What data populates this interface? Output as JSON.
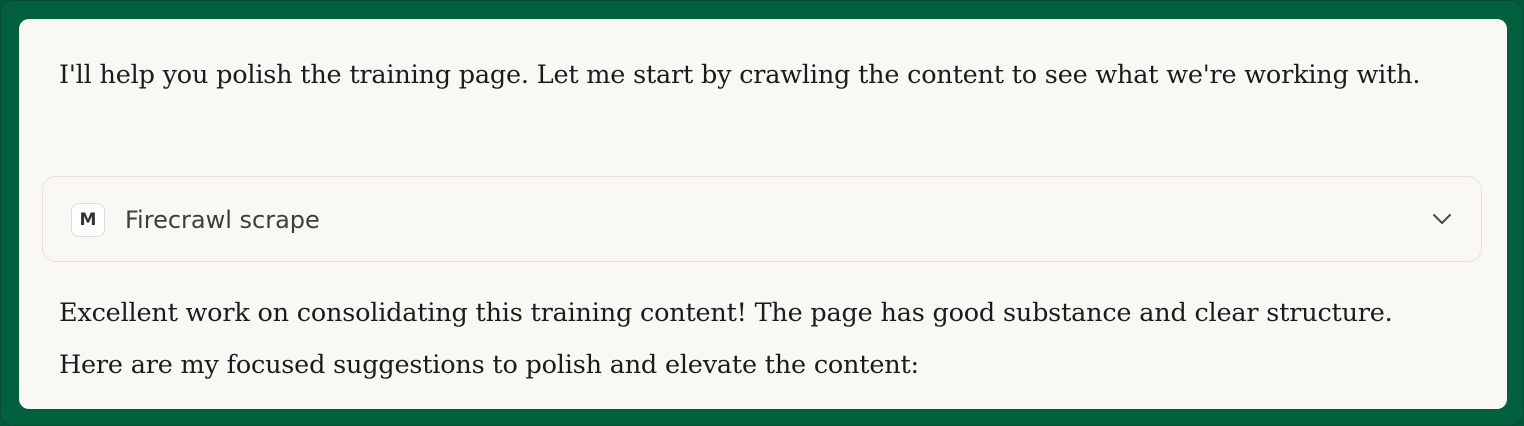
{
  "message": {
    "intro_text": "I'll help you polish the training page. Let me start by crawling the content to see what we're working with.",
    "followup_text": "Excellent work on consolidating this training content! The page has good substance and clear structure. Here are my focused suggestions to polish and elevate the content:"
  },
  "tool_call": {
    "badge_letter": "M",
    "label": "Firecrawl scrape",
    "icon": "chevron-down-icon",
    "expanded": false
  },
  "colors": {
    "frame_green": "#00593a",
    "card_background": "#f9f8f5",
    "text": "#1c1b19"
  }
}
